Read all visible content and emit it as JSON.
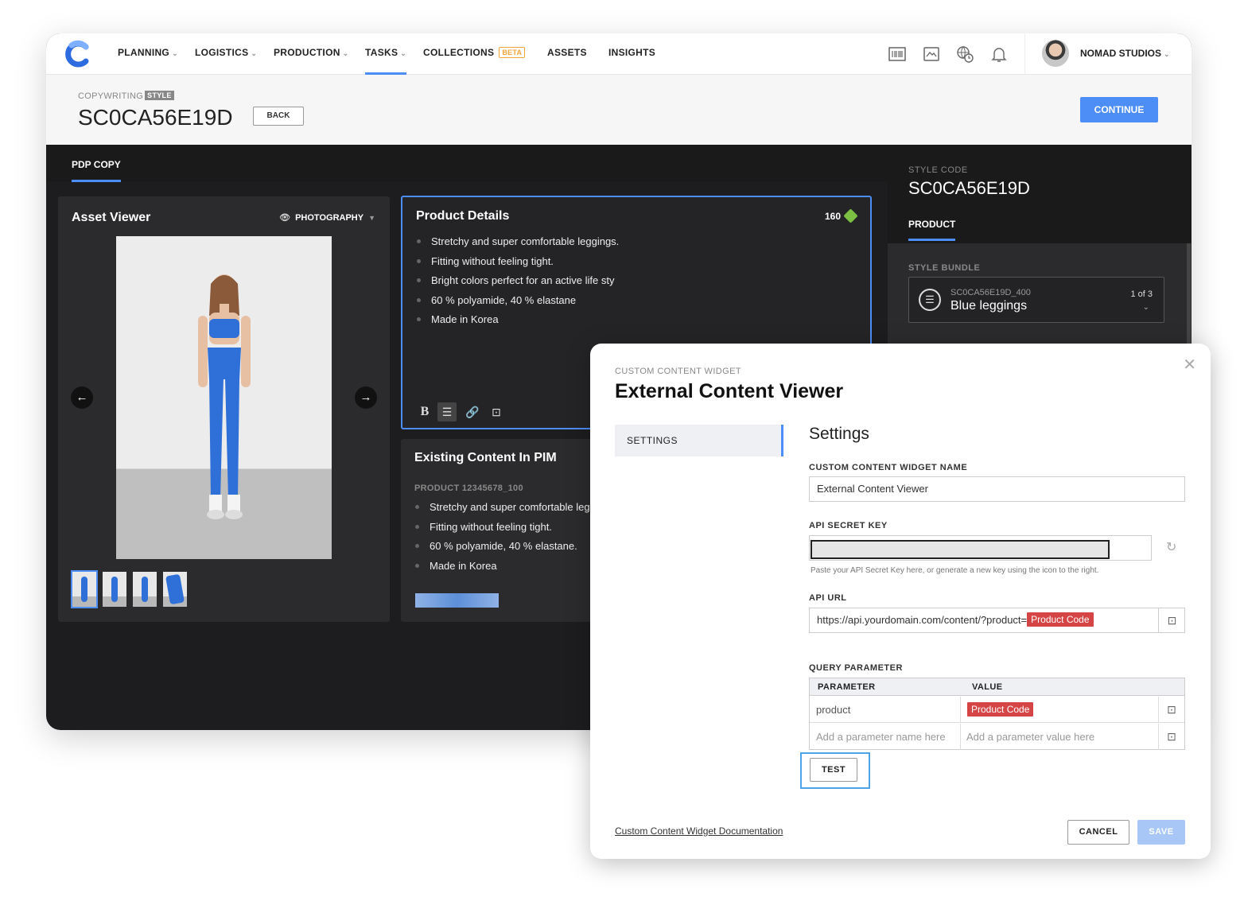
{
  "nav": {
    "items": [
      {
        "label": "PLANNING",
        "has_caret": true
      },
      {
        "label": "LOGISTICS",
        "has_caret": true
      },
      {
        "label": "PRODUCTION",
        "has_caret": true
      },
      {
        "label": "TASKS",
        "has_caret": true,
        "active": true
      },
      {
        "label": "COLLECTIONS",
        "badge": "BETA"
      },
      {
        "label": "ASSETS"
      },
      {
        "label": "INSIGHTS"
      }
    ],
    "account_name": "NOMAD STUDIOS",
    "icons": [
      "barcode-icon",
      "image-frame-icon",
      "globe-clock-icon",
      "bell-icon"
    ],
    "accent_color": "#4d8df6"
  },
  "header": {
    "crumb": "COPYWRITING",
    "crumb_tag": "STYLE",
    "title": "SC0CA56E19D",
    "back_label": "BACK",
    "continue_label": "CONTINUE"
  },
  "tabs": {
    "active": "PDP COPY"
  },
  "asset_viewer": {
    "title": "Asset Viewer",
    "filter_label": "PHOTOGRAPHY",
    "thumbnail_count": 4
  },
  "product_details": {
    "title": "Product Details",
    "char_count": "160",
    "bullets": [
      "Stretchy and super comfortable leggings.",
      "Fitting without feeling tight.",
      "Bright colors perfect for an active life sty",
      "60 % polyamide, 40 % elastane",
      "Made in Korea"
    ],
    "toolbar": {
      "bold": "B"
    }
  },
  "pim": {
    "title": "Existing Content In PIM",
    "code": "PRODUCT 12345678_100",
    "bullets": [
      "Stretchy and super comfortable leg",
      "Fitting without feeling tight.",
      "60 % polyamide, 40 % elastane.",
      "Made in Korea"
    ]
  },
  "side": {
    "style_code_label": "STYLE CODE",
    "style_code": "SC0CA56E19D",
    "tab": "PRODUCT",
    "bundle_label": "STYLE BUNDLE",
    "bundle_code": "SC0CA56E19D_400",
    "bundle_name": "Blue leggings",
    "bundle_count": "1 of 3"
  },
  "modal": {
    "overline": "CUSTOM CONTENT WIDGET",
    "title": "External Content Viewer",
    "nav_item": "SETTINGS",
    "section_title": "Settings",
    "name_label": "CUSTOM CONTENT WIDGET NAME",
    "name_value": "External Content Viewer",
    "secret_label": "API SECRET KEY",
    "secret_help": "Paste your API Secret Key here, or generate a new key using the icon to the right.",
    "url_label": "API URL",
    "url_value": "https://api.yourdomain.com/content/?product=",
    "url_token": "Product Code",
    "query_label": "QUERY PARAMETER",
    "col_param": "PARAMETER",
    "col_value": "VALUE",
    "row1_param": "product",
    "row1_value": "Product Code",
    "row2_param_placeholder": "Add a parameter name here",
    "row2_value_placeholder": "Add a parameter value here",
    "test_label": "TEST",
    "doc_link": "Custom Content Widget Documentation",
    "cancel_label": "CANCEL",
    "save_label": "SAVE",
    "token_color": "#d64545"
  }
}
